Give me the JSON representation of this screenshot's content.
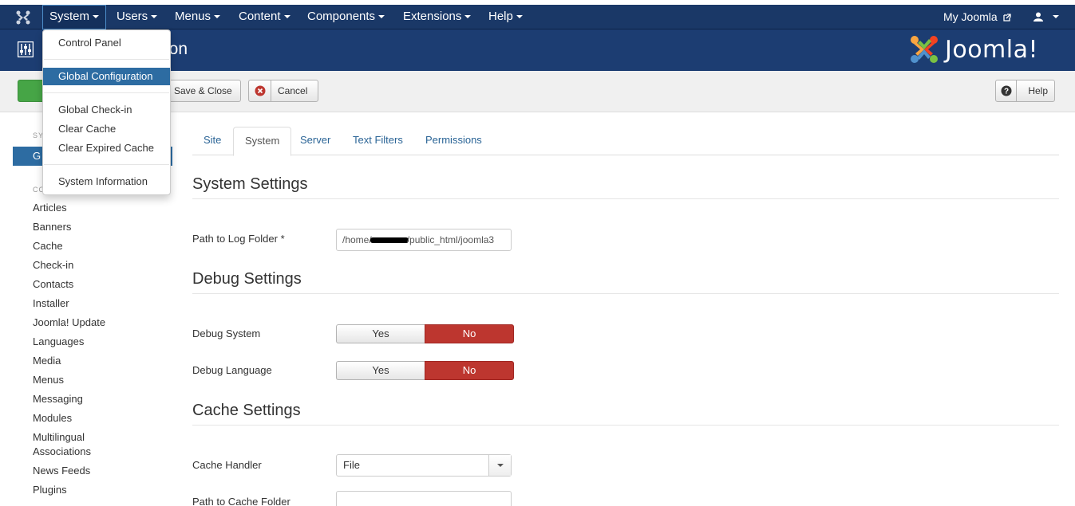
{
  "navbar": {
    "brand_icon": "joomla-icon",
    "items": [
      {
        "label": "System"
      },
      {
        "label": "Users"
      },
      {
        "label": "Menus"
      },
      {
        "label": "Content"
      },
      {
        "label": "Components"
      },
      {
        "label": "Extensions"
      },
      {
        "label": "Help"
      }
    ],
    "my_joomla": "My Joomla",
    "user_icon": "user-icon",
    "colors": {
      "navbar": "#1a3867",
      "subhead": "#1c3d72"
    }
  },
  "subhead": {
    "title_fragment": "ion",
    "logo_text": "Joomla!"
  },
  "dropdown": {
    "items": [
      {
        "label": "Control Panel"
      },
      {
        "label": "Global Configuration"
      },
      {
        "label": "Global Check-in"
      },
      {
        "label": "Clear Cache"
      },
      {
        "label": "Clear Expired Cache"
      },
      {
        "label": "System Information"
      }
    ]
  },
  "toolbar": {
    "save_close_label": "Save & Close",
    "cancel_label": "Cancel",
    "help_label": "Help"
  },
  "sidebar": {
    "section1_fragment": "SY",
    "active_fragment": "G",
    "section2_fragment": "CO",
    "links": [
      "Articles",
      "Banners",
      "Cache",
      "Check-in",
      "Contacts",
      "Installer",
      "Joomla! Update",
      "Languages",
      "Media",
      "Menus",
      "Messaging",
      "Modules",
      "Multilingual Associations",
      "News Feeds",
      "Plugins"
    ]
  },
  "tabs": [
    {
      "label": "Site"
    },
    {
      "label": "System"
    },
    {
      "label": "Server"
    },
    {
      "label": "Text Filters"
    },
    {
      "label": "Permissions"
    }
  ],
  "system_settings": {
    "heading": "System Settings",
    "log_folder_label": "Path to Log Folder *",
    "log_folder_prefix": "/home/",
    "log_folder_suffix": "/public_html/joomla3"
  },
  "debug_settings": {
    "heading": "Debug Settings",
    "debug_system_label": "Debug System",
    "debug_language_label": "Debug Language",
    "yes": "Yes",
    "no": "No"
  },
  "cache_settings": {
    "heading": "Cache Settings",
    "handler_label": "Cache Handler",
    "handler_value": "File",
    "cache_folder_label": "Path to Cache Folder"
  }
}
